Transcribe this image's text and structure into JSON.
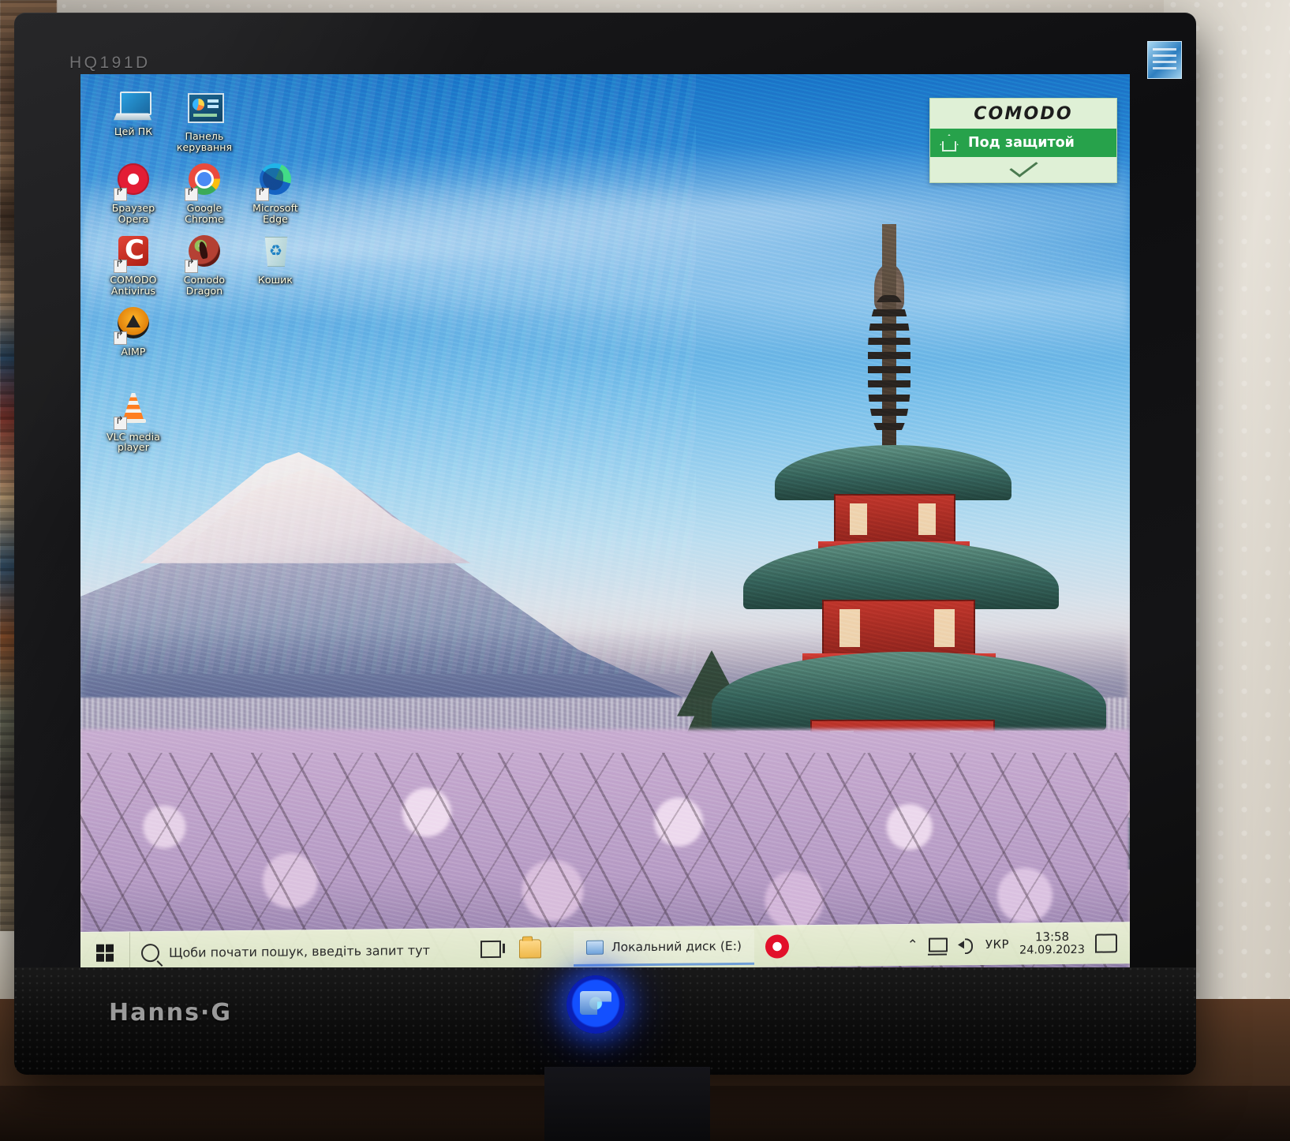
{
  "monitor": {
    "model_label": "HQ191D",
    "brand_logo": "Hanns·G",
    "energy_sticker": "energy-star-sticker"
  },
  "desktop": {
    "icons": [
      {
        "label": "Цей ПК",
        "icon": "this-pc-icon",
        "shortcut": false
      },
      {
        "label": "Панель керування",
        "icon": "control-panel-icon",
        "shortcut": false
      },
      {
        "label": "Браузер Opera",
        "icon": "opera-browser-icon",
        "shortcut": true
      },
      {
        "label": "Google Chrome",
        "icon": "google-chrome-icon",
        "shortcut": true
      },
      {
        "label": "Microsoft Edge",
        "icon": "microsoft-edge-icon",
        "shortcut": true
      },
      {
        "label": "COMODO Antivirus",
        "icon": "comodo-antivirus-icon",
        "shortcut": true
      },
      {
        "label": "Comodo Dragon",
        "icon": "comodo-dragon-icon",
        "shortcut": true
      },
      {
        "label": "Кошик",
        "icon": "recycle-bin-icon",
        "shortcut": false
      },
      {
        "label": "AIMP",
        "icon": "aimp-icon",
        "shortcut": true
      },
      {
        "label": "VLC media player",
        "icon": "vlc-media-player-icon",
        "shortcut": true
      }
    ],
    "wallpaper_description": "mount-fuji-pagoda-cherry-blossom-wallpaper"
  },
  "comodo_widget": {
    "brand": "COMODO",
    "status_text": "Под защитой",
    "home_icon": "home-icon",
    "expand_icon": "chevron-down-icon",
    "colors": {
      "panel": "#dff0d6",
      "status_bar": "#27a24b",
      "status_text": "#ffffff"
    }
  },
  "taskbar": {
    "start_button": "start-button",
    "search": {
      "icon": "search-icon",
      "placeholder": "Щоби почати пошук, введіть запит тут",
      "value": ""
    },
    "task_view": "task-view-icon",
    "pinned_apps": [
      {
        "name": "file-explorer",
        "label": "Провідник"
      }
    ],
    "open_windows": [
      {
        "title": "Локальний диск (E:)",
        "icon": "drive-icon",
        "active": true
      }
    ],
    "running_apps": [
      {
        "name": "opera",
        "label": "Opera"
      }
    ],
    "tray": {
      "expand_icon": "chevron-up-icon",
      "network_icon": "network-icon",
      "volume_icon": "volume-icon",
      "language": "УКР",
      "clock_time": "13:58",
      "clock_date": "24.09.2023",
      "action_center_icon": "action-center-icon"
    }
  }
}
